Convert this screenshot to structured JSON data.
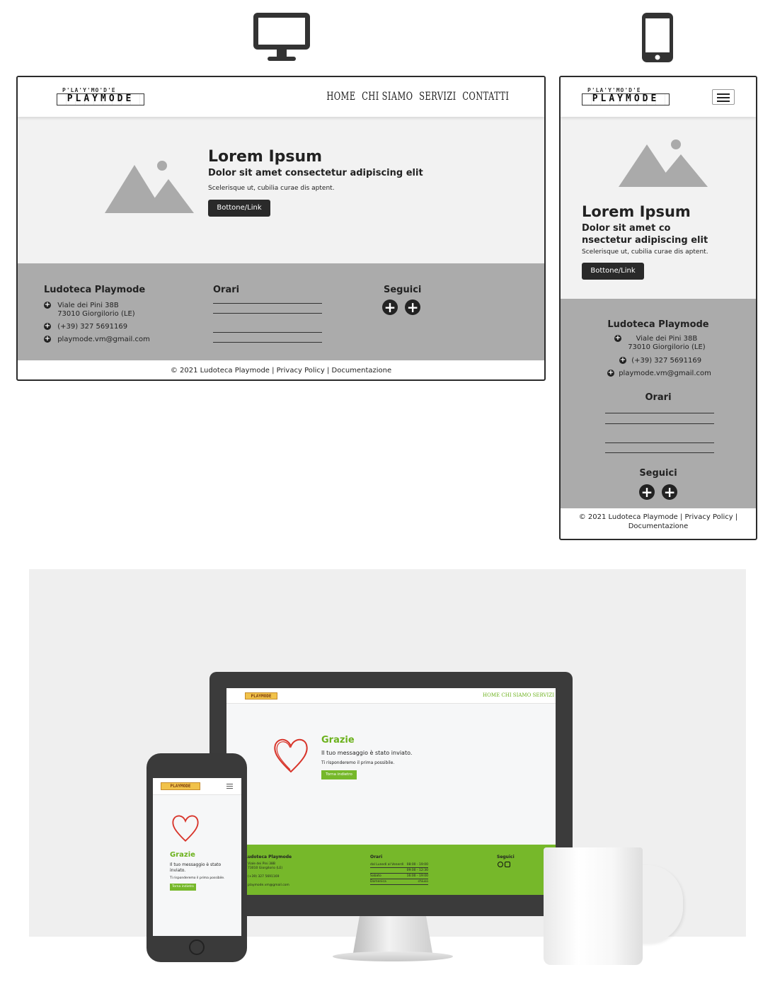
{
  "icons": {
    "desktop": "desktop-monitor-icon",
    "mobile": "smartphone-icon",
    "hamburger": "hamburger-menu-icon",
    "image_placeholder": "image-placeholder-icon",
    "heart": "heart-icon"
  },
  "colors": {
    "wire_dark": "#2a2a2a",
    "wire_light": "#f2f2f2",
    "wire_footer": "#ababab",
    "brand_green": "#76b82a"
  },
  "logo": {
    "top": "P'LA'Y'MO'D'E",
    "main": "PLAYMODE"
  },
  "nav": [
    "HOME",
    "CHI SIAMO",
    "SERVIZI",
    "CONTATTI"
  ],
  "wireframe": {
    "title": "Lorem Ipsum",
    "subtitle": "Dolor sit amet consectetur adipiscing elit",
    "subtitle_mobile_1": "Dolor sit amet co",
    "subtitle_mobile_2": "nsectetur adipiscing elit",
    "text": "Scelerisque ut, cubilia curae dis aptent.",
    "button": "Bottone/Link"
  },
  "footer": {
    "org": "Ludoteca Playmode",
    "address1": "Viale dei Pini 38B",
    "address2": "73010 Giorgilorio (LE)",
    "phone": "(+39) 327 5691169",
    "email": "playmode.vm@gmail.com",
    "hours_title": "Orari",
    "social_title": "Seguici",
    "copyright": "© 2021 Ludoteca Playmode | Privacy Policy | Documentazione",
    "copyright_m1": "© 2021 Ludoteca Playmode | Privacy Policy |",
    "copyright_m2": "Documentazione"
  },
  "mockup": {
    "title": "Grazie",
    "message": "Il tuo messaggio è stato inviato.",
    "message_m1": "Il tuo messaggio è stato",
    "message_m2": "inviato.",
    "sub": "Ti risponderemo il prima possibile.",
    "back": "Torna indietro",
    "hours": [
      {
        "day": "dal Lunedì al Venerdì",
        "time": "08:00 - 19:00"
      },
      {
        "day": "",
        "time": "09:00 - 12:30"
      },
      {
        "day": "Sabato",
        "time": "16:00 - 19:00"
      },
      {
        "day": "Domenica",
        "time": "chiuso"
      }
    ]
  }
}
